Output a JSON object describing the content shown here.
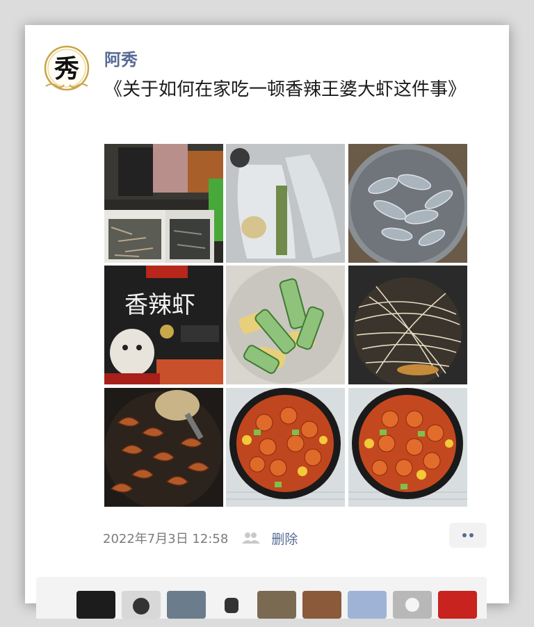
{
  "post": {
    "username": "阿秀",
    "text": "《关于如何在家吃一顿香辣王婆大虾这件事》",
    "timestamp": "2022年7月3日 12:58",
    "delete_label": "删除"
  },
  "avatar": {
    "glyph": "秀",
    "icon": "calligraphy-logo"
  },
  "photos": [
    {
      "id": "photo-market-shrimp-tanks"
    },
    {
      "id": "photo-plastic-bags"
    },
    {
      "id": "photo-raw-shrimp-colander"
    },
    {
      "id": "photo-seasoning-package",
      "package_text": "香辣虾"
    },
    {
      "id": "photo-cucumber-corn"
    },
    {
      "id": "photo-noodles-pan"
    },
    {
      "id": "photo-frying-shrimp"
    },
    {
      "id": "photo-finished-dish-1"
    },
    {
      "id": "photo-finished-dish-2"
    }
  ],
  "colors": {
    "link_blue": "#576b95",
    "text_dark": "#1b1b1b",
    "meta_gray": "#7b7b7b"
  }
}
